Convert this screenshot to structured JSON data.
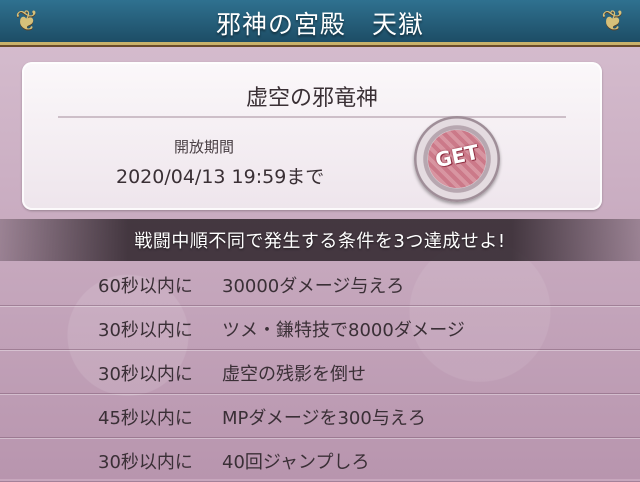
{
  "header": {
    "title": "邪神の宮殿　天獄",
    "corner_icon_left": "ornament-icon",
    "corner_icon_right": "ornament-icon"
  },
  "info_panel": {
    "boss_name": "虚空の邪竜神",
    "period_label": "開放期間",
    "period_date": "2020/04/13  19:59まで",
    "badge_text": "GET",
    "badge_icon": "get-stamp-icon"
  },
  "banner": {
    "text": "戦闘中順不同で発生する条件を3つ達成せよ!"
  },
  "conditions": [
    {
      "time": "60秒以内に",
      "task": "30000ダメージ与えろ"
    },
    {
      "time": "30秒以内に",
      "task": "ツメ・鎌特技で8000ダメージ"
    },
    {
      "time": "30秒以内に",
      "task": "虚空の残影を倒せ"
    },
    {
      "time": "45秒以内に",
      "task": "MPダメージを300与えろ"
    },
    {
      "time": "30秒以内に",
      "task": "40回ジャンプしろ"
    }
  ],
  "colors": {
    "header_bg": "#2f7190",
    "header_border": "#c9b26a",
    "page_bg": "#c7a7bd",
    "panel_bg": "#fbf8fa",
    "banner_bg": "#2d232a"
  }
}
